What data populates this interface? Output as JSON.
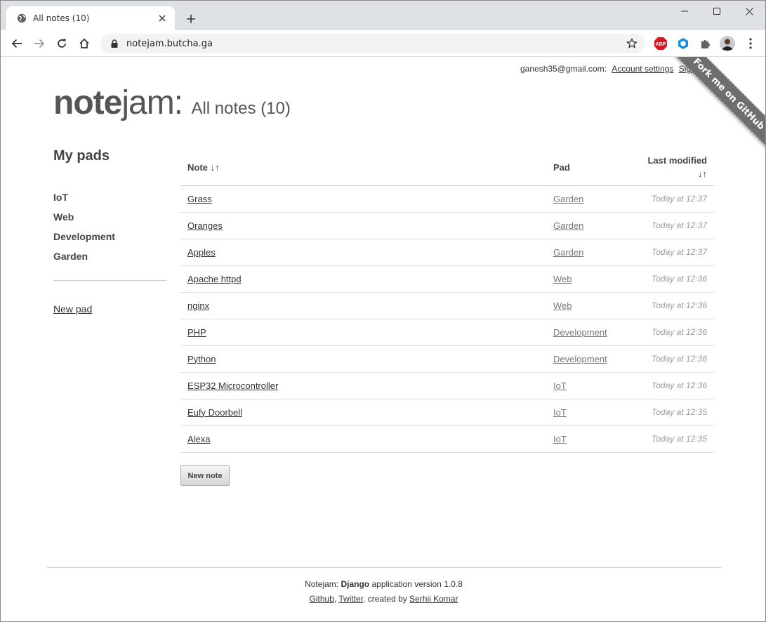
{
  "browser": {
    "tab_title": "All notes (10)",
    "url": "notejam.butcha.ga",
    "extension_abp_label": "ABP"
  },
  "header": {
    "user_email": "ganesh35@gmail.com:",
    "account_settings": "Account settings",
    "signout": "Sign out",
    "brand_bold": "note",
    "brand_light": "jam:",
    "page_title": "All notes (10)",
    "ribbon": "Fork me on GitHub"
  },
  "sidebar": {
    "title": "My pads",
    "pads": [
      "IoT",
      "Web",
      "Development",
      "Garden"
    ],
    "new_pad": "New pad"
  },
  "table": {
    "col_note": "Note",
    "col_pad": "Pad",
    "col_modified": "Last modified",
    "sort_glyph": "↓↑",
    "rows": [
      {
        "note": "Grass",
        "pad": "Garden",
        "modified": "Today at 12:37"
      },
      {
        "note": "Oranges",
        "pad": "Garden",
        "modified": "Today at 12:37"
      },
      {
        "note": "Apples",
        "pad": "Garden",
        "modified": "Today at 12:37"
      },
      {
        "note": "Apache httpd",
        "pad": "Web",
        "modified": "Today at 12:36"
      },
      {
        "note": "nginx",
        "pad": "Web",
        "modified": "Today at 12:36"
      },
      {
        "note": "PHP",
        "pad": "Development",
        "modified": "Today at 12:36"
      },
      {
        "note": "Python",
        "pad": "Development",
        "modified": "Today at 12:36"
      },
      {
        "note": "ESP32 Microcontroller",
        "pad": "IoT",
        "modified": "Today at 12:36"
      },
      {
        "note": "Eufy Doorbell",
        "pad": "IoT",
        "modified": "Today at 12:35"
      },
      {
        "note": "Alexa",
        "pad": "IoT",
        "modified": "Today at 12:35"
      }
    ]
  },
  "new_note": "New note",
  "footer": {
    "prefix": "Notejam:",
    "framework": "Django",
    "suffix": "application version 1.0.8",
    "github": "Github",
    "twitter": "Twitter",
    "created_by": ", created by",
    "author": "Serhii Komar"
  },
  "colors": {
    "tabbar": "#dee1e6",
    "omnibox": "#f1f3f4",
    "ribbon": "#6e6e6e",
    "abp": "#e0141e",
    "ext_blue": "#1a8fe0"
  }
}
